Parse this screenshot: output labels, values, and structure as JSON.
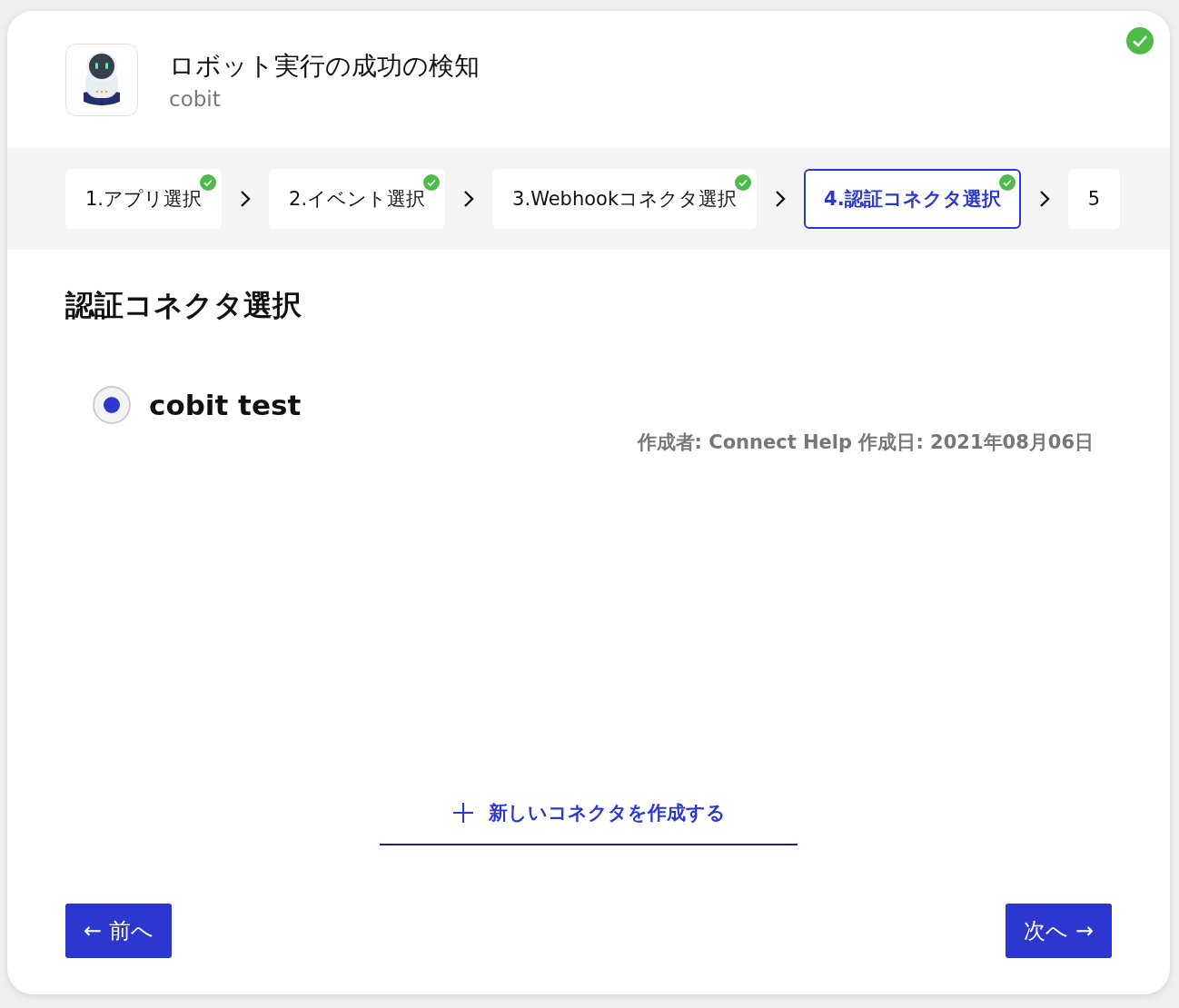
{
  "header": {
    "title": "ロボット実行の成功の検知",
    "subtitle": "cobit",
    "complete": true
  },
  "steps": [
    {
      "label": "1.アプリ選択",
      "done": true,
      "selected": false
    },
    {
      "label": "2.イベント選択",
      "done": true,
      "selected": false
    },
    {
      "label": "3.Webhookコネクタ選択",
      "done": true,
      "selected": false
    },
    {
      "label": "4.認証コネクタ選択",
      "done": true,
      "selected": true
    },
    {
      "label": "5",
      "done": false,
      "selected": false
    }
  ],
  "section_title": "認証コネクタ選択",
  "connectors": [
    {
      "name": "cobit test",
      "selected": true,
      "meta": "作成者: Connect Help 作成日: 2021年08月06日"
    }
  ],
  "create_link": "新しいコネクタを作成する",
  "buttons": {
    "prev": "← 前へ",
    "next": "次へ →"
  }
}
